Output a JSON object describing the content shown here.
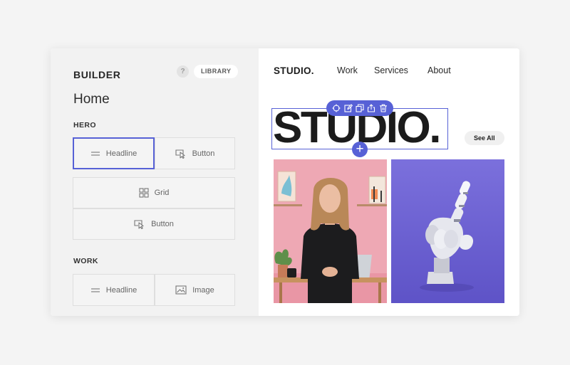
{
  "builder": {
    "title": "BUILDER",
    "help": "?",
    "library_label": "LIBRARY",
    "page_title": "Home",
    "sections": [
      {
        "label": "HERO",
        "blocks": [
          {
            "label": "Headline",
            "icon": "headline-icon",
            "selected": true
          },
          {
            "label": "Button",
            "icon": "cursor-click-icon"
          },
          {
            "label": "Grid",
            "icon": "grid-icon"
          },
          {
            "label": "Button",
            "icon": "cursor-click-icon"
          }
        ]
      },
      {
        "label": "WORK",
        "blocks": [
          {
            "label": "Headline",
            "icon": "headline-icon"
          },
          {
            "label": "Image",
            "icon": "image-icon"
          }
        ]
      }
    ]
  },
  "preview": {
    "logo": "STUDIO.",
    "nav": [
      "Work",
      "Services",
      "About"
    ],
    "hero_text": "STUDIO.",
    "see_all": "See All",
    "toolbar_icons": [
      "move-icon",
      "edit-icon",
      "duplicate-icon",
      "share-icon",
      "delete-icon"
    ],
    "add_icon": "+",
    "images": [
      {
        "icon": "photo-woman-portrait"
      },
      {
        "icon": "photo-robot-hand"
      }
    ]
  },
  "colors": {
    "accent": "#5761d6",
    "panel_bg": "#f2f2f2",
    "page_bg": "#f4f4f4",
    "image1_bg": "#eda5b2",
    "image2_bg": "#6e63d5"
  }
}
